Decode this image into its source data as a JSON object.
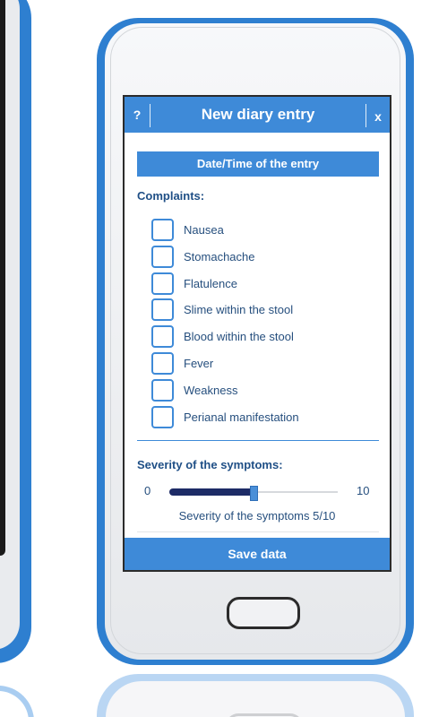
{
  "titlebar": {
    "help_label": "?",
    "title": "New diary entry",
    "close_label": "x"
  },
  "date_button_label": "Date/Time of the entry",
  "complaints": {
    "label": "Complaints:",
    "items": [
      {
        "label": "Nausea",
        "checked": false
      },
      {
        "label": "Stomachache",
        "checked": false
      },
      {
        "label": "Flatulence",
        "checked": false
      },
      {
        "label": "Slime within the stool",
        "checked": false
      },
      {
        "label": "Blood within the stool",
        "checked": false
      },
      {
        "label": "Fever",
        "checked": false
      },
      {
        "label": "Weakness",
        "checked": false
      },
      {
        "label": "Perianal manifestation",
        "checked": false
      }
    ]
  },
  "severity": {
    "label": "Severity of the symptoms:",
    "min_label": "0",
    "max_label": "10",
    "min": 0,
    "max": 10,
    "value": 5,
    "value_text": "Severity of the symptoms 5/10"
  },
  "save_label": "Save data",
  "colors": {
    "accent": "#3e8ad8",
    "frame": "#2e7fd0",
    "text": "#264f7e",
    "slider_fill": "#1d2b66"
  },
  "icons": {
    "home": "home-button-icon"
  }
}
